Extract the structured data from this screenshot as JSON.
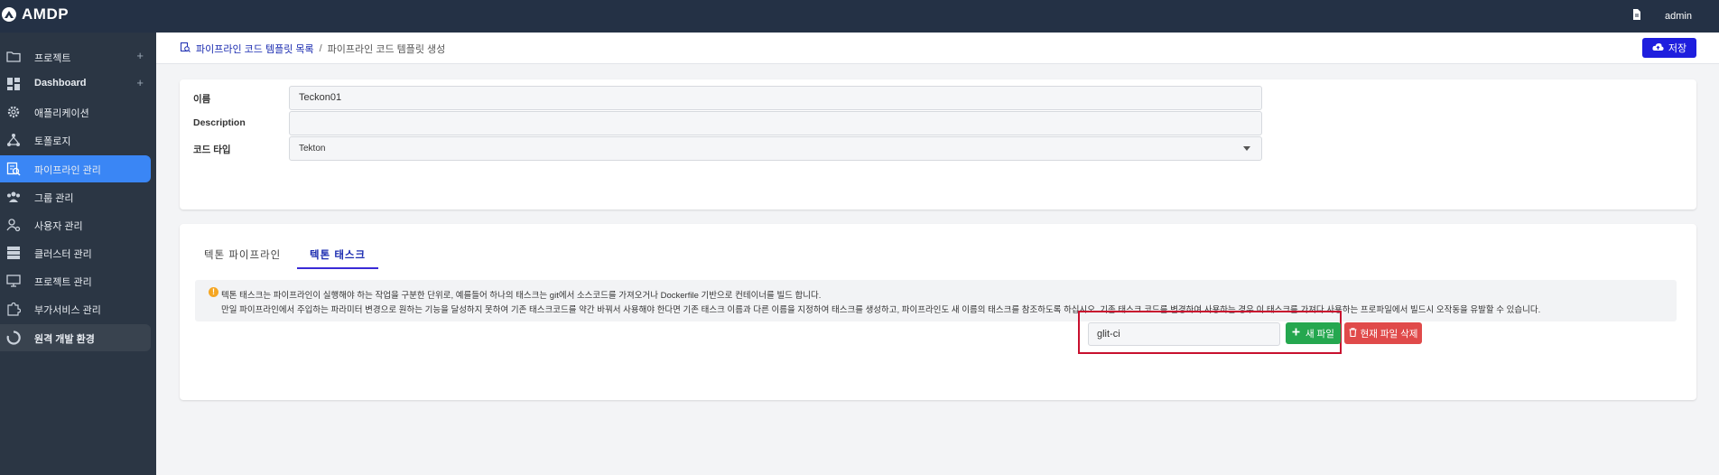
{
  "app": {
    "title": "AMDP"
  },
  "topbar": {
    "user": "admin",
    "doc_icon": "document-icon"
  },
  "sidebar": {
    "items": [
      {
        "label": "프로젝트",
        "icon": "folder-icon",
        "plus": "+"
      },
      {
        "label": "Dashboard",
        "icon": "dashboard-icon",
        "plus": "+"
      },
      {
        "label": "애플리케이션",
        "icon": "gear-icon"
      },
      {
        "label": "토폴로지",
        "icon": "topology-icon"
      },
      {
        "label": "파이프라인 관리",
        "icon": "pipeline-icon",
        "active": true
      },
      {
        "label": "그룹 관리",
        "icon": "group-icon"
      },
      {
        "label": "사용자 관리",
        "icon": "user-gear-icon"
      },
      {
        "label": "클러스터 관리",
        "icon": "server-icon"
      },
      {
        "label": "프로젝트 관리",
        "icon": "monitor-icon"
      },
      {
        "label": "부가서비스 관리",
        "icon": "puzzle-icon"
      },
      {
        "label": "원격 개발 환경",
        "icon": "loader-icon"
      }
    ]
  },
  "breadcrumb": {
    "link": "파이프라인 코드 템플릿 목록",
    "sep": "/",
    "current": "파이프라인 코드 템플릿 생성"
  },
  "toolbar": {
    "save_label": "저장"
  },
  "form": {
    "name_label": "이름",
    "name_value": "Teckon01",
    "description_label": "Description",
    "description_value": "",
    "code_type_label": "코드 타입",
    "code_type_value": "Tekton"
  },
  "tabs": [
    {
      "label": "텍톤 파이프라인",
      "active": false
    },
    {
      "label": "텍톤 태스크",
      "active": true
    }
  ],
  "info": {
    "line1": "텍톤 태스크는 파이프라인이 실행해야 하는 작업을 구분한 단위로, 예를들어 하나의 태스크는 git에서 소스코드를 가져오거나 Dockerfile 기반으로 컨테이너를 빌드 합니다.",
    "line2": "만일 파이프라인에서 주입하는 파라미터 변경으로 원하는 기능을 달성하지 못하여 기존 태스크코드를 약간 바꿔서 사용해야 한다면 기존 태스크 이름과 다른 이름을 지정하여 태스크를 생성하고, 파이프라인도 새 이름의 태스크를 참조하도록 하십시오. 기존 태스크 코드를 변경하여 사용하는 경우 이 태스크를 가져다 사용하는 프로파일에서 빌드시 오작동을 유발할 수 있습니다."
  },
  "file": {
    "value": "glit-ci",
    "new_label": "새 파일",
    "delete_label": "현재 파일 삭제"
  },
  "colors": {
    "accent": "#1e1ede",
    "active_nav": "#3a86f5",
    "success": "#25a74f",
    "danger": "#e04a4a",
    "highlight": "#c8102e"
  }
}
